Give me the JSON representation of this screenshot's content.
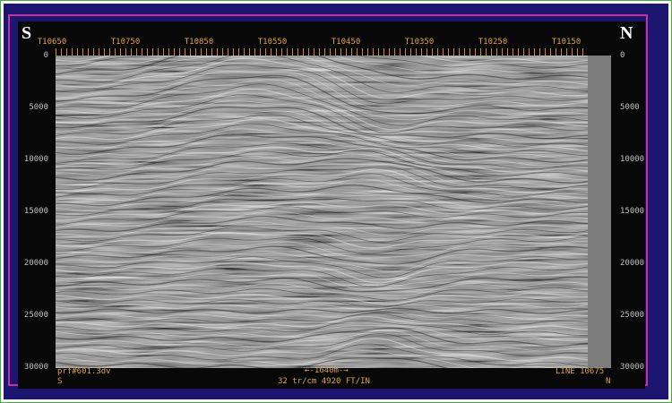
{
  "directions": {
    "left": "S",
    "right": "N"
  },
  "trace_labels": [
    "T10650",
    "T10750",
    "T10850",
    "T10550",
    "T10450",
    "T10350",
    "T10250",
    "T10150"
  ],
  "depth_ticks": [
    "0",
    "5000",
    "10000",
    "15000",
    "20000",
    "25000",
    "30000"
  ],
  "footer": {
    "left_line1": "prf#601.3dv",
    "left_line2": "S",
    "center_line1": "←-1640m-→",
    "center_line2": "32 tr/cm 4920 FT/IN",
    "right_line1": "LINE 10675",
    "right_line2": "N"
  },
  "colors": {
    "outer_border": "#3fae3f",
    "frame_blue": "#1d1670",
    "frame_pink": "#c4329a",
    "label_orange": "#e2a33a"
  }
}
